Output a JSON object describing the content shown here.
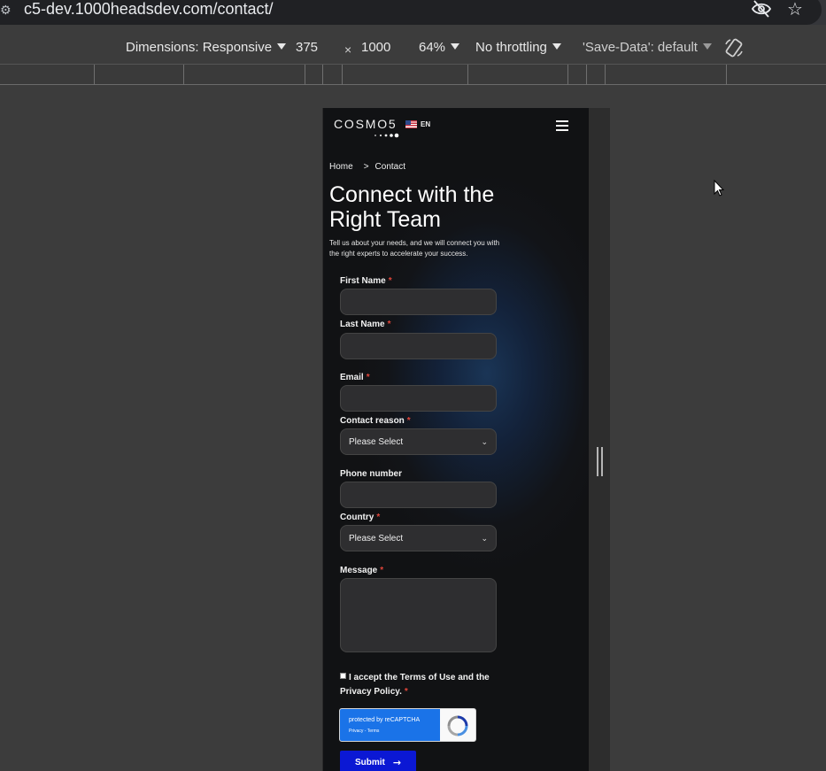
{
  "browser": {
    "url": "c5-dev.1000headsdev.com/contact/",
    "site_icon": "site-info-icon",
    "icons": [
      "eye-off-icon",
      "star-icon"
    ]
  },
  "devtools": {
    "dimensions_label": "Dimensions: Responsive",
    "width": "375",
    "times": "×",
    "height": "1000",
    "zoom": "64%",
    "throttling": "No throttling",
    "save_data": "'Save-Data': default"
  },
  "site": {
    "logo": "COSMO5",
    "language": "EN",
    "breadcrumb": {
      "home": "Home",
      "separator": ">",
      "current": "Contact"
    },
    "title": "Connect with the Right Team",
    "intro": "Tell us about your needs, and we will connect you with the right experts to accelerate your success.",
    "form": {
      "first_name_label": "First Name",
      "last_name_label": "Last Name",
      "email_label": "Email",
      "contact_reason_label": "Contact reason",
      "contact_reason_value": "Please Select",
      "phone_label": "Phone number",
      "country_label": "Country",
      "country_value": "Please Select",
      "message_label": "Message",
      "required_mark": "*",
      "terms_text": "I accept the Terms of Use and the Privacy Policy.",
      "recaptcha_main": "protected by reCAPTCHA",
      "recaptcha_sub": "Privacy - Terms",
      "submit_label": "Submit"
    }
  },
  "colors": {
    "required": "#e0453a",
    "submit_bg": "#0b18d4",
    "recaptcha_blue": "#1a73e8"
  }
}
